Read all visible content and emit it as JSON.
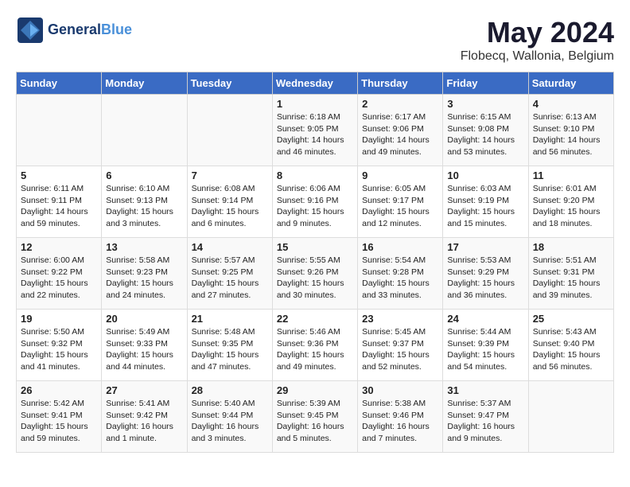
{
  "header": {
    "logo_general": "General",
    "logo_blue": "Blue",
    "month_title": "May 2024",
    "location": "Flobecq, Wallonia, Belgium"
  },
  "days_of_week": [
    "Sunday",
    "Monday",
    "Tuesday",
    "Wednesday",
    "Thursday",
    "Friday",
    "Saturday"
  ],
  "weeks": [
    {
      "days": [
        {
          "number": "",
          "sunrise": "",
          "sunset": "",
          "daylight": ""
        },
        {
          "number": "",
          "sunrise": "",
          "sunset": "",
          "daylight": ""
        },
        {
          "number": "",
          "sunrise": "",
          "sunset": "",
          "daylight": ""
        },
        {
          "number": "1",
          "sunrise": "Sunrise: 6:18 AM",
          "sunset": "Sunset: 9:05 PM",
          "daylight": "Daylight: 14 hours and 46 minutes."
        },
        {
          "number": "2",
          "sunrise": "Sunrise: 6:17 AM",
          "sunset": "Sunset: 9:06 PM",
          "daylight": "Daylight: 14 hours and 49 minutes."
        },
        {
          "number": "3",
          "sunrise": "Sunrise: 6:15 AM",
          "sunset": "Sunset: 9:08 PM",
          "daylight": "Daylight: 14 hours and 53 minutes."
        },
        {
          "number": "4",
          "sunrise": "Sunrise: 6:13 AM",
          "sunset": "Sunset: 9:10 PM",
          "daylight": "Daylight: 14 hours and 56 minutes."
        }
      ]
    },
    {
      "days": [
        {
          "number": "5",
          "sunrise": "Sunrise: 6:11 AM",
          "sunset": "Sunset: 9:11 PM",
          "daylight": "Daylight: 14 hours and 59 minutes."
        },
        {
          "number": "6",
          "sunrise": "Sunrise: 6:10 AM",
          "sunset": "Sunset: 9:13 PM",
          "daylight": "Daylight: 15 hours and 3 minutes."
        },
        {
          "number": "7",
          "sunrise": "Sunrise: 6:08 AM",
          "sunset": "Sunset: 9:14 PM",
          "daylight": "Daylight: 15 hours and 6 minutes."
        },
        {
          "number": "8",
          "sunrise": "Sunrise: 6:06 AM",
          "sunset": "Sunset: 9:16 PM",
          "daylight": "Daylight: 15 hours and 9 minutes."
        },
        {
          "number": "9",
          "sunrise": "Sunrise: 6:05 AM",
          "sunset": "Sunset: 9:17 PM",
          "daylight": "Daylight: 15 hours and 12 minutes."
        },
        {
          "number": "10",
          "sunrise": "Sunrise: 6:03 AM",
          "sunset": "Sunset: 9:19 PM",
          "daylight": "Daylight: 15 hours and 15 minutes."
        },
        {
          "number": "11",
          "sunrise": "Sunrise: 6:01 AM",
          "sunset": "Sunset: 9:20 PM",
          "daylight": "Daylight: 15 hours and 18 minutes."
        }
      ]
    },
    {
      "days": [
        {
          "number": "12",
          "sunrise": "Sunrise: 6:00 AM",
          "sunset": "Sunset: 9:22 PM",
          "daylight": "Daylight: 15 hours and 22 minutes."
        },
        {
          "number": "13",
          "sunrise": "Sunrise: 5:58 AM",
          "sunset": "Sunset: 9:23 PM",
          "daylight": "Daylight: 15 hours and 24 minutes."
        },
        {
          "number": "14",
          "sunrise": "Sunrise: 5:57 AM",
          "sunset": "Sunset: 9:25 PM",
          "daylight": "Daylight: 15 hours and 27 minutes."
        },
        {
          "number": "15",
          "sunrise": "Sunrise: 5:55 AM",
          "sunset": "Sunset: 9:26 PM",
          "daylight": "Daylight: 15 hours and 30 minutes."
        },
        {
          "number": "16",
          "sunrise": "Sunrise: 5:54 AM",
          "sunset": "Sunset: 9:28 PM",
          "daylight": "Daylight: 15 hours and 33 minutes."
        },
        {
          "number": "17",
          "sunrise": "Sunrise: 5:53 AM",
          "sunset": "Sunset: 9:29 PM",
          "daylight": "Daylight: 15 hours and 36 minutes."
        },
        {
          "number": "18",
          "sunrise": "Sunrise: 5:51 AM",
          "sunset": "Sunset: 9:31 PM",
          "daylight": "Daylight: 15 hours and 39 minutes."
        }
      ]
    },
    {
      "days": [
        {
          "number": "19",
          "sunrise": "Sunrise: 5:50 AM",
          "sunset": "Sunset: 9:32 PM",
          "daylight": "Daylight: 15 hours and 41 minutes."
        },
        {
          "number": "20",
          "sunrise": "Sunrise: 5:49 AM",
          "sunset": "Sunset: 9:33 PM",
          "daylight": "Daylight: 15 hours and 44 minutes."
        },
        {
          "number": "21",
          "sunrise": "Sunrise: 5:48 AM",
          "sunset": "Sunset: 9:35 PM",
          "daylight": "Daylight: 15 hours and 47 minutes."
        },
        {
          "number": "22",
          "sunrise": "Sunrise: 5:46 AM",
          "sunset": "Sunset: 9:36 PM",
          "daylight": "Daylight: 15 hours and 49 minutes."
        },
        {
          "number": "23",
          "sunrise": "Sunrise: 5:45 AM",
          "sunset": "Sunset: 9:37 PM",
          "daylight": "Daylight: 15 hours and 52 minutes."
        },
        {
          "number": "24",
          "sunrise": "Sunrise: 5:44 AM",
          "sunset": "Sunset: 9:39 PM",
          "daylight": "Daylight: 15 hours and 54 minutes."
        },
        {
          "number": "25",
          "sunrise": "Sunrise: 5:43 AM",
          "sunset": "Sunset: 9:40 PM",
          "daylight": "Daylight: 15 hours and 56 minutes."
        }
      ]
    },
    {
      "days": [
        {
          "number": "26",
          "sunrise": "Sunrise: 5:42 AM",
          "sunset": "Sunset: 9:41 PM",
          "daylight": "Daylight: 15 hours and 59 minutes."
        },
        {
          "number": "27",
          "sunrise": "Sunrise: 5:41 AM",
          "sunset": "Sunset: 9:42 PM",
          "daylight": "Daylight: 16 hours and 1 minute."
        },
        {
          "number": "28",
          "sunrise": "Sunrise: 5:40 AM",
          "sunset": "Sunset: 9:44 PM",
          "daylight": "Daylight: 16 hours and 3 minutes."
        },
        {
          "number": "29",
          "sunrise": "Sunrise: 5:39 AM",
          "sunset": "Sunset: 9:45 PM",
          "daylight": "Daylight: 16 hours and 5 minutes."
        },
        {
          "number": "30",
          "sunrise": "Sunrise: 5:38 AM",
          "sunset": "Sunset: 9:46 PM",
          "daylight": "Daylight: 16 hours and 7 minutes."
        },
        {
          "number": "31",
          "sunrise": "Sunrise: 5:37 AM",
          "sunset": "Sunset: 9:47 PM",
          "daylight": "Daylight: 16 hours and 9 minutes."
        },
        {
          "number": "",
          "sunrise": "",
          "sunset": "",
          "daylight": ""
        }
      ]
    }
  ]
}
